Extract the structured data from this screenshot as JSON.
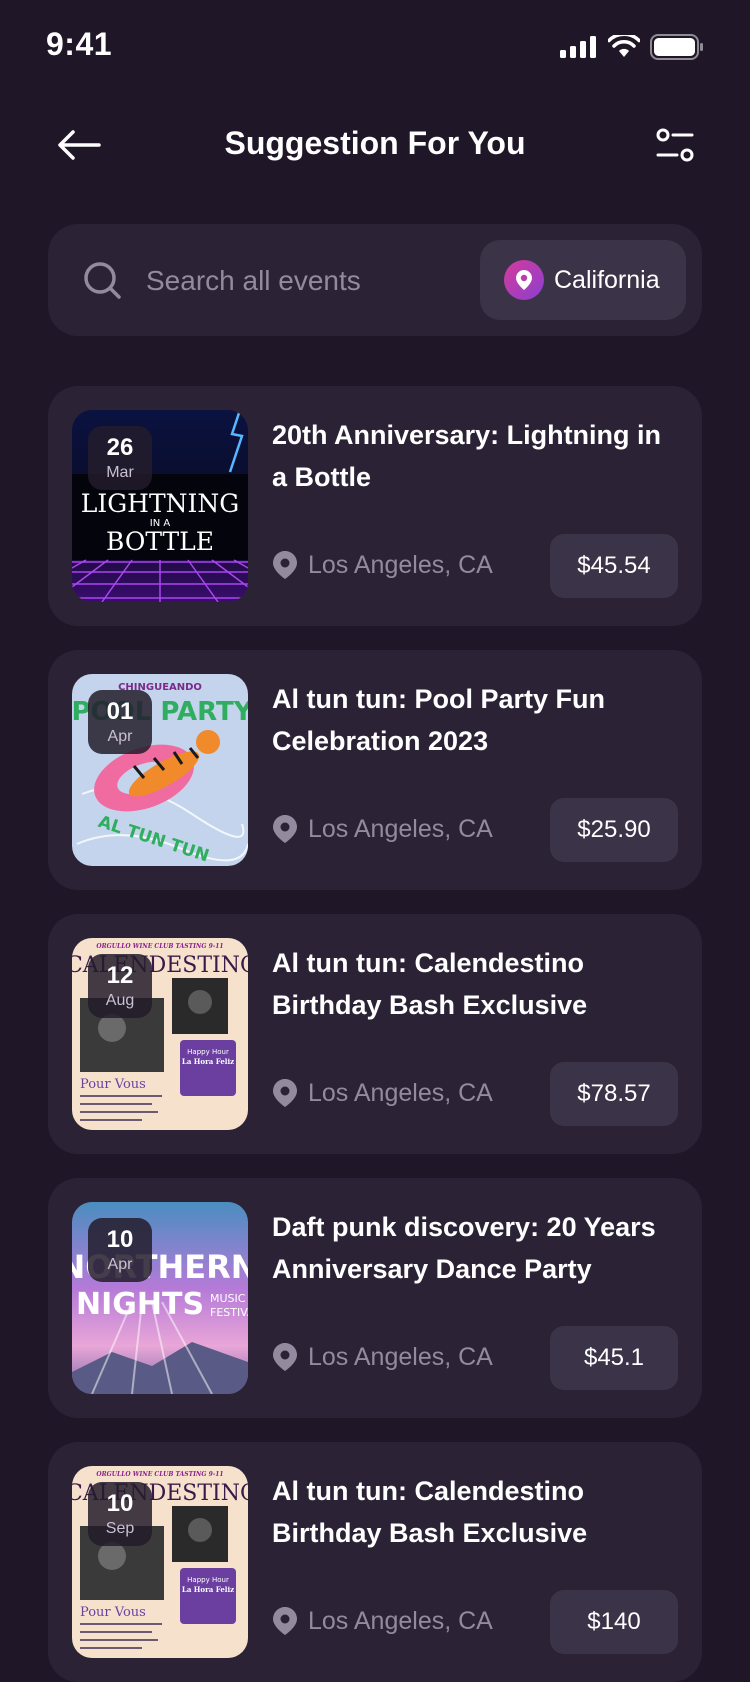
{
  "status": {
    "time": "9:41"
  },
  "header": {
    "title": "Suggestion For You"
  },
  "search": {
    "placeholder": "Search all events",
    "location": "California"
  },
  "events": [
    {
      "day": "26",
      "month": "Mar",
      "title": "20th Anniversary: Lightning in a Bottle",
      "location": "Los Angeles, CA",
      "price": "$45.54",
      "poster_text": [
        "LIGHTNING",
        "IN A",
        "BOTTLE"
      ]
    },
    {
      "day": "01",
      "month": "Apr",
      "title": "Al tun tun: Pool Party Fun Celebration 2023",
      "location": "Los Angeles, CA",
      "price": "$25.90",
      "poster_text": [
        "CHINGUEANDO",
        "POOL PARTY",
        "AL TUN TUN"
      ]
    },
    {
      "day": "12",
      "month": "Aug",
      "title": "Al tun tun: Calendestino Birthday Bash Exclusive",
      "location": "Los Angeles, CA",
      "price": "$78.57",
      "poster_text": [
        "ORGULLO WINE CLUB TASTING 9-11",
        "CALENDESTINO",
        "Pour Vous",
        "Happy Hour",
        "La Hora Feliz"
      ]
    },
    {
      "day": "10",
      "month": "Apr",
      "title": "Daft punk discovery: 20 Years Anniversary Dance Party",
      "location": "Los Angeles, CA",
      "price": "$45.1",
      "poster_text": [
        "NORTHERN",
        "NIGHTS",
        "MUSIC",
        "FESTIVAL"
      ]
    },
    {
      "day": "10",
      "month": "Sep",
      "title": "Al tun tun: Calendestino Birthday Bash Exclusive",
      "location": "Los Angeles, CA",
      "price": "$140",
      "poster_text": [
        "ORGULLO WINE CLUB TASTING 9-11",
        "CALENDESTINO",
        "Pour Vous",
        "Happy Hour",
        "La Hora Feliz"
      ]
    }
  ],
  "colors": {
    "background": "#1f1627",
    "card": "#2b2235",
    "chip": "#3b3347",
    "muted_text": "#948aa0",
    "accent_pink": "#d43b9a",
    "accent_purple": "#8a3fd1"
  },
  "icons": {
    "back": "arrow-left-icon",
    "filter": "sliders-icon",
    "search": "search-icon",
    "location": "map-pin-icon"
  }
}
